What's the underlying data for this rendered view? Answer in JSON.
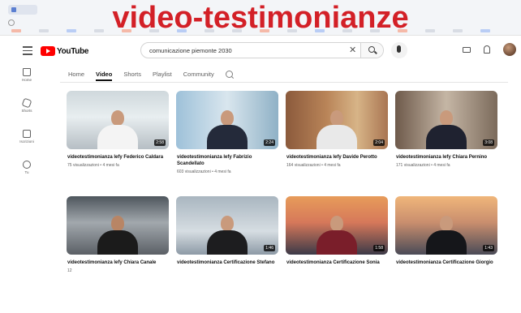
{
  "caption": "video-testimonianze",
  "topbar": {
    "logo_text": "YouTube",
    "search_query": "comunicazione piemonte 2030"
  },
  "rail": {
    "items": [
      {
        "label": "Home",
        "icon": "home-icon"
      },
      {
        "label": "Shorts",
        "icon": "shorts-icon"
      },
      {
        "label": "Iscrizioni",
        "icon": "subscriptions-icon"
      },
      {
        "label": "Tu",
        "icon": "you-icon"
      }
    ]
  },
  "tabs": [
    {
      "label": "Home",
      "active": false
    },
    {
      "label": "Video",
      "active": true
    },
    {
      "label": "Shorts",
      "active": false
    },
    {
      "label": "Playlist",
      "active": false
    },
    {
      "label": "Community",
      "active": false
    }
  ],
  "videos": [
    {
      "title": "videotestimonianza lefy Federico Caldara",
      "stats": "75 visualizzazioni • 4 mesi fa",
      "duration": "2:58"
    },
    {
      "title": "videotestimonianza lefy Fabrizio Scandellato",
      "stats": "603 visualizzazioni • 4 mesi fa",
      "duration": "2:24"
    },
    {
      "title": "videotestimonianza lefy Davide Perotto",
      "stats": "164 visualizzazioni • 4 mesi fa",
      "duration": "2:04"
    },
    {
      "title": "videotestimonianza lefy Chiara Pernino",
      "stats": "171 visualizzazioni • 4 mesi fa",
      "duration": "3:08"
    },
    {
      "title": "videotestimonianza lefy Chiara Canale",
      "stats": "12",
      "duration": ""
    },
    {
      "title": "videotestimonianza Certificazione Stefano",
      "stats": "",
      "duration": "1:46"
    },
    {
      "title": "videotestimonianza Certificazione Sonia",
      "stats": "",
      "duration": "1:58"
    },
    {
      "title": "videotestimonianza Certificazione Giorgio",
      "stats": "",
      "duration": "1:43"
    }
  ],
  "colors": {
    "caption": "#d32027",
    "youtube_red": "#ff0000",
    "text": "#0f0f0f",
    "muted": "#606060"
  }
}
